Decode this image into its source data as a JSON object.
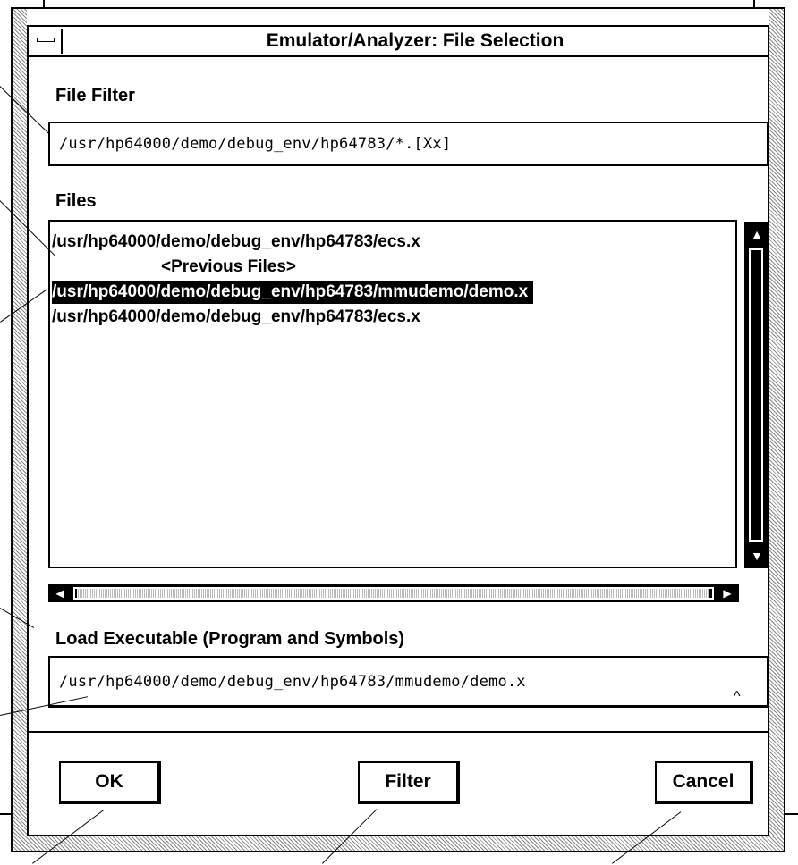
{
  "window": {
    "title": "Emulator/Analyzer: File Selection"
  },
  "file_filter": {
    "label": "File Filter",
    "value": "/usr/hp64000/demo/debug_env/hp64783/*.[Xx]"
  },
  "files": {
    "label": "Files",
    "items": [
      {
        "text": "/usr/hp64000/demo/debug_env/hp64783/ecs.x",
        "selected": false
      },
      {
        "text": "<Previous Files>",
        "selected": false
      },
      {
        "text": "/usr/hp64000/demo/debug_env/hp64783/mmudemo/demo.x",
        "selected": true
      },
      {
        "text": "/usr/hp64000/demo/debug_env/hp64783/ecs.x",
        "selected": false
      }
    ]
  },
  "load_executable": {
    "label": "Load Executable (Program and Symbols)",
    "value": "/usr/hp64000/demo/debug_env/hp64783/mmudemo/demo.x"
  },
  "buttons": {
    "ok": "OK",
    "filter": "Filter",
    "cancel": "Cancel"
  },
  "icons": {
    "window_menu": "window-menu-icon",
    "scroll_up": "arrow-up-icon",
    "scroll_down": "arrow-down-icon",
    "scroll_left": "arrow-left-icon",
    "scroll_right": "arrow-right-icon",
    "caret": "insertion-caret-icon"
  }
}
